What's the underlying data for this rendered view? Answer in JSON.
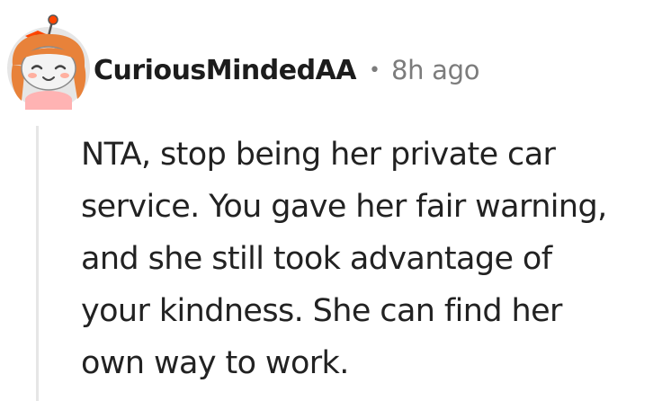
{
  "comment": {
    "author": "CuriousMindedAA",
    "separator": "•",
    "timestamp": "8h ago",
    "body_lines": [
      "NTA, stop being her private car",
      "service. You gave her fair warning,",
      "and she still took advantage of",
      "your kindness. She can find her",
      "own way to work."
    ]
  },
  "avatar": {
    "icon": "snoo-avatar-icon",
    "colors": {
      "hair": "#e8823a",
      "skin": "#f3f3f3",
      "bow": "#ff4500",
      "shirt": "#ffb3b3",
      "background": "#e6e6e6"
    }
  }
}
